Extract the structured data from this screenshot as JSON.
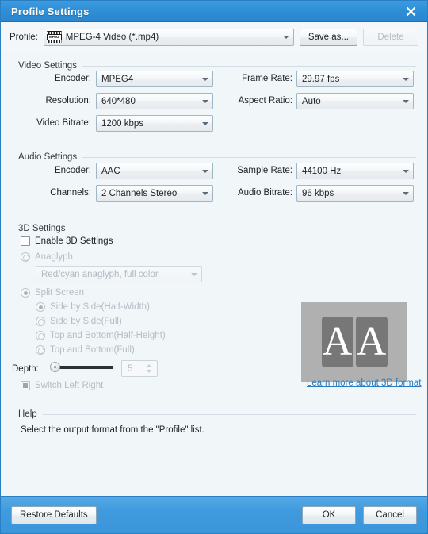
{
  "window": {
    "title": "Profile Settings",
    "close_icon": "close-icon"
  },
  "profile_bar": {
    "label": "Profile:",
    "icon": "mpeg-file-icon",
    "icon_text": "MPEG",
    "value": "MPEG-4 Video (*.mp4)",
    "save_as_label": "Save as...",
    "delete_label": "Delete"
  },
  "video_settings": {
    "title": "Video Settings",
    "encoder_label": "Encoder:",
    "encoder_value": "MPEG4",
    "resolution_label": "Resolution:",
    "resolution_value": "640*480",
    "bitrate_label": "Video Bitrate:",
    "bitrate_value": "1200 kbps",
    "framerate_label": "Frame Rate:",
    "framerate_value": "29.97 fps",
    "aspect_label": "Aspect Ratio:",
    "aspect_value": "Auto"
  },
  "audio_settings": {
    "title": "Audio Settings",
    "encoder_label": "Encoder:",
    "encoder_value": "AAC",
    "channels_label": "Channels:",
    "channels_value": "2 Channels Stereo",
    "samplerate_label": "Sample Rate:",
    "samplerate_value": "44100 Hz",
    "bitrate_label": "Audio Bitrate:",
    "bitrate_value": "96 kbps"
  },
  "settings_3d": {
    "title": "3D Settings",
    "enable_label": "Enable 3D Settings",
    "anaglyph_label": "Anaglyph",
    "anaglyph_value": "Red/cyan anaglyph, full color",
    "split_screen_label": "Split Screen",
    "split_options": [
      "Side by Side(Half-Width)",
      "Side by Side(Full)",
      "Top and Bottom(Half-Height)",
      "Top and Bottom(Full)"
    ],
    "depth_label": "Depth:",
    "depth_value": "5",
    "switch_label": "Switch Left Right",
    "learn_more": "Learn more about 3D format",
    "preview_letter_left": "A",
    "preview_letter_right": "A"
  },
  "help": {
    "title": "Help",
    "text": "Select the output format from the \"Profile\" list."
  },
  "footer": {
    "restore_label": "Restore Defaults",
    "ok_label": "OK",
    "cancel_label": "Cancel"
  },
  "colors": {
    "titlebar_blue": "#2e8ed6",
    "footer_blue": "#3f9ade",
    "link_blue": "#2a7bbd",
    "dialog_bg": "#f1f6f9"
  }
}
